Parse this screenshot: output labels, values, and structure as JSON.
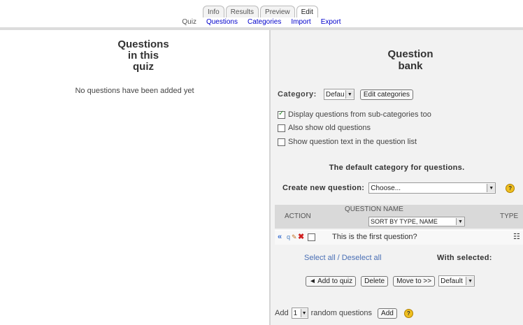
{
  "tabs": [
    "Info",
    "Results",
    "Preview",
    "Edit"
  ],
  "subtabs": [
    "Quiz",
    "Questions",
    "Categories",
    "Import",
    "Export"
  ],
  "left": {
    "title_lines": [
      "Questions",
      "in this",
      "quiz"
    ],
    "empty_message": "No questions have been added yet"
  },
  "bank": {
    "title_lines": [
      "Question",
      "bank"
    ],
    "category_label": "Category:",
    "category_value": "Default",
    "edit_categories": "Edit categories",
    "options": [
      {
        "label": "Display questions from sub-categories too",
        "checked": true
      },
      {
        "label": "Also show old questions",
        "checked": false
      },
      {
        "label": "Show question text in the question list",
        "checked": false
      }
    ],
    "category_info": "The default category for questions.",
    "create_label": "Create new question:",
    "create_value": "Choose...",
    "table": {
      "col_action": "ACTION",
      "col_name": "QUESTION NAME",
      "sort_value": "SORT BY TYPE, NAME",
      "col_type": "TYPE",
      "rows": [
        {
          "name": "This is the first question?"
        }
      ]
    },
    "select_all": "Select all",
    "deselect_all": "Deselect all",
    "with_selected": "With selected:",
    "add_to_quiz": "◄ Add to quiz",
    "delete": "Delete",
    "move_to": "Move to >>",
    "move_target": "Default",
    "random_prefix": "Add",
    "random_count": "1",
    "random_suffix": "random questions",
    "random_add": "Add"
  },
  "colors": {
    "link": "#4a6fb5",
    "panel_bg": "#f2f2f2",
    "header_bg": "#d9d9d9"
  }
}
